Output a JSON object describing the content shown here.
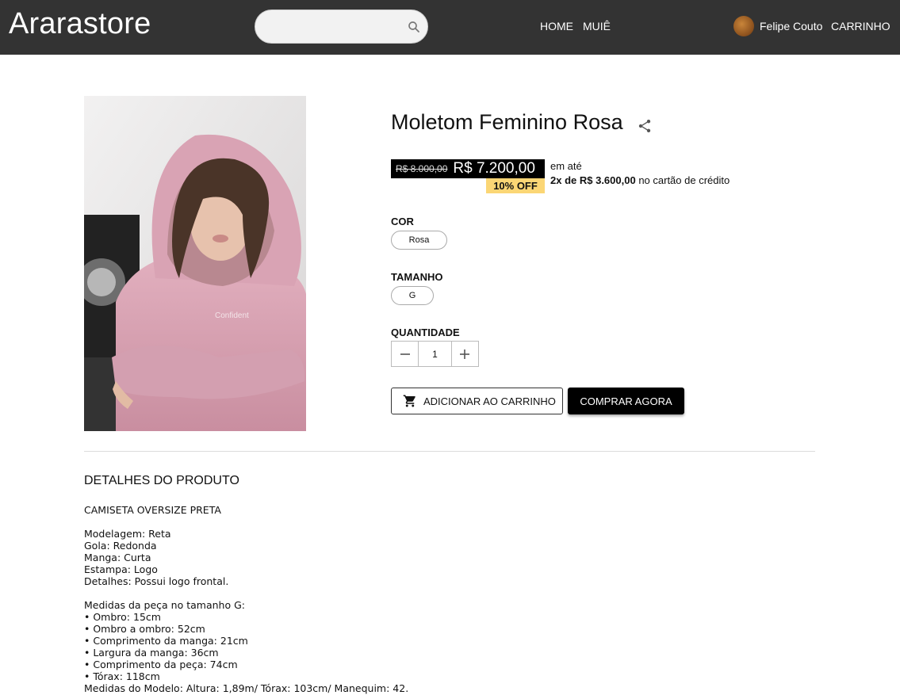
{
  "header": {
    "logo": "Ararastore",
    "search": {
      "value": "",
      "placeholder": ""
    },
    "nav": [
      "HOME",
      "MUIÊ"
    ],
    "user_name": "Felipe Couto",
    "cart_label": "CARRINHO"
  },
  "product": {
    "title": "Moletom Feminino Rosa",
    "old_price": "R$ 8.000,00",
    "new_price": "R$ 7.200,00",
    "discount": "10% OFF",
    "installment_label": "em até",
    "installment_bold": "2x de R$ 3.600,00",
    "installment_suffix": " no cartão de crédito",
    "color_label": "COR",
    "color_value": "Rosa",
    "size_label": "TAMANHO",
    "size_value": "G",
    "qty_label": "QUANTIDADE",
    "qty_value": "1",
    "add_to_cart": "ADICIONAR AO CARRINHO",
    "buy_now": "COMPRAR AGORA",
    "image_print": "Confident"
  },
  "details": {
    "title": "DETALHES DO PRODUTO",
    "body": "CAMISETA OVERSIZE PRETA\n\nModelagem: Reta\nGola: Redonda\nManga: Curta\nEstampa: Logo\nDetalhes: Possui logo frontal.\n\nMedidas da peça no tamanho G:\n• Ombro: 15cm\n• Ombro a ombro: 52cm\n• Comprimento da manga: 21cm\n• Largura da manga: 36cm\n• Comprimento da peça: 74cm\n• Tórax: 118cm\nMedidas do Modelo: Altura: 1,89m/ Tórax: 103cm/ Manequim: 42."
  },
  "colors": {
    "header_bg": "#333333",
    "accent_black": "#000000",
    "badge_yellow": "#fbd675",
    "hoodie_pink": "#d9a1b3"
  },
  "icons": [
    "search-icon",
    "share-icon",
    "cart-icon",
    "minus-icon",
    "plus-icon",
    "avatar"
  ]
}
